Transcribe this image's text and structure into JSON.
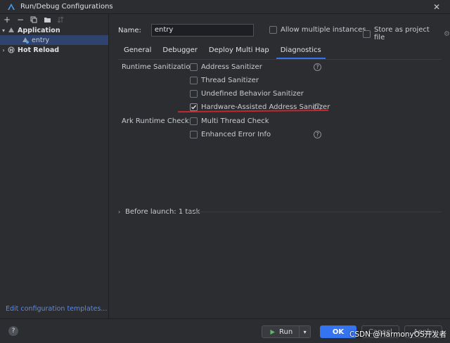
{
  "window": {
    "title": "Run/Debug Configurations"
  },
  "toolbar": {
    "add_icon": "plus-icon",
    "remove_icon": "minus-icon",
    "copy_icon": "copy-icon",
    "folder_icon": "folder-icon",
    "sort_icon": "sort-icon"
  },
  "tree": {
    "application": "Application",
    "entry": "entry",
    "hot_reload": "Hot Reload"
  },
  "left_link": "Edit configuration templates...",
  "config": {
    "name_label": "Name:",
    "name_value": "entry",
    "allow_multiple": "Allow multiple instances",
    "store_as_project": "Store as project file"
  },
  "tabs": [
    {
      "label": "General"
    },
    {
      "label": "Debugger"
    },
    {
      "label": "Deploy Multi Hap"
    },
    {
      "label": "Diagnostics"
    }
  ],
  "diagnostics": {
    "runtime_label": "Runtime Sanitization:",
    "ark_label": "Ark Runtime Check:",
    "address_sanitizer": "Address Sanitizer",
    "thread_sanitizer": "Thread Sanitizer",
    "ub_sanitizer": "Undefined Behavior Sanitizer",
    "hw_address_sanitizer": "Hardware-Assisted Address Sanitizer",
    "multi_thread_check": "Multi Thread Check",
    "enhanced_error_info": "Enhanced Error Info",
    "help_glyph": "?"
  },
  "before_launch": "Before launch: 1 task",
  "buttons": {
    "help": "?",
    "run": "Run",
    "ok": "OK",
    "cancel": "Cancel",
    "apply": "Apply"
  },
  "watermark": "CSDN @HarmonyOS开发者",
  "colors": {
    "accent": "#3574f0",
    "link": "#548af7",
    "highlight": "#c4282f"
  }
}
